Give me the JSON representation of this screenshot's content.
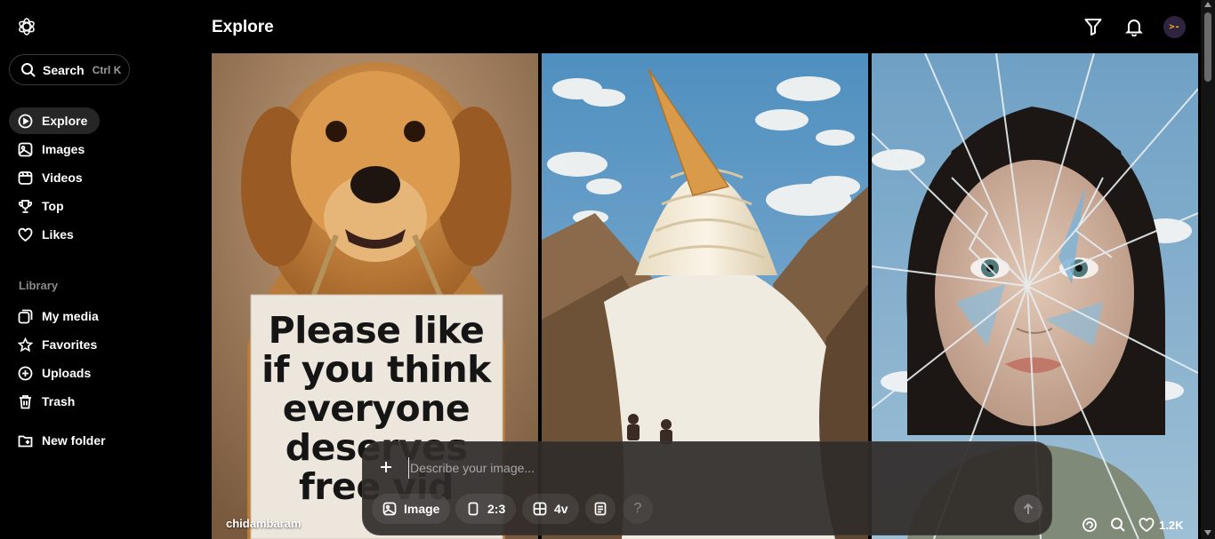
{
  "sidebar": {
    "search": {
      "label": "Search",
      "shortcut": "Ctrl K"
    },
    "main_items": [
      {
        "label": "Explore",
        "icon": "compass-icon",
        "active": true
      },
      {
        "label": "Images",
        "icon": "image-icon"
      },
      {
        "label": "Videos",
        "icon": "video-icon"
      },
      {
        "label": "Top",
        "icon": "trophy-icon"
      },
      {
        "label": "Likes",
        "icon": "heart-icon"
      }
    ],
    "library_label": "Library",
    "library_items": [
      {
        "label": "My media",
        "icon": "media-icon"
      },
      {
        "label": "Favorites",
        "icon": "star-icon"
      },
      {
        "label": "Uploads",
        "icon": "upload-icon"
      },
      {
        "label": "Trash",
        "icon": "trash-icon"
      }
    ],
    "new_folder": {
      "label": "New folder",
      "icon": "folder-plus-icon"
    }
  },
  "header": {
    "title": "Explore",
    "avatar_text": ">-"
  },
  "gallery": {
    "tiles": [
      {
        "sign_text": "Please like if you think everyone deserves free vid",
        "author": "chidambaram"
      },
      {},
      {
        "likes": "1.2K"
      }
    ]
  },
  "composer": {
    "placeholder": "Describe your image...",
    "chips": [
      {
        "label": "Image",
        "icon": "image-icon"
      },
      {
        "label": "2:3",
        "icon": "portrait-ratio-icon"
      },
      {
        "label": "4v",
        "icon": "grid-icon"
      }
    ],
    "help_label": "?"
  },
  "colors": {
    "background": "#000000",
    "active_nav": "#262626",
    "composer_bg": "#302c2a",
    "muted_text": "#8a8a8a"
  }
}
